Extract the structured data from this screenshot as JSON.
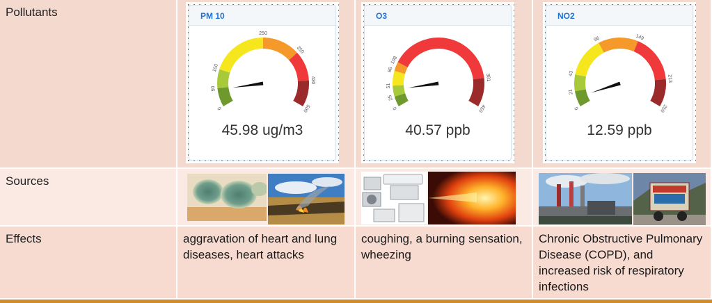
{
  "rows": {
    "pollutants": "Pollutants",
    "sources": "Sources",
    "effects": "Effects"
  },
  "gauges": [
    {
      "title": "PM 10",
      "reading": "45.98 ug/m3",
      "max": 500,
      "value": 45.98,
      "ticks": [
        "0",
        "50",
        "100",
        "250",
        "350",
        "430",
        "500"
      ],
      "tick_values": [
        0,
        50,
        100,
        250,
        350,
        430,
        500
      ],
      "bands": [
        {
          "from": 0,
          "to": 50,
          "color": "#6e9a2d"
        },
        {
          "from": 50,
          "to": 100,
          "color": "#a8c93a"
        },
        {
          "from": 100,
          "to": 250,
          "color": "#f5e61e"
        },
        {
          "from": 250,
          "to": 350,
          "color": "#f59a2a"
        },
        {
          "from": 350,
          "to": 430,
          "color": "#f0393a"
        },
        {
          "from": 430,
          "to": 500,
          "color": "#9b2b2b"
        }
      ]
    },
    {
      "title": "O3",
      "reading": "40.57 ppb",
      "max": 450,
      "value": 40.57,
      "ticks": [
        "0",
        "25",
        "51",
        "86",
        "108",
        "381",
        "450"
      ],
      "tick_values": [
        0,
        25,
        51,
        86,
        108,
        381,
        450
      ],
      "bands": [
        {
          "from": 0,
          "to": 25,
          "color": "#6e9a2d"
        },
        {
          "from": 25,
          "to": 51,
          "color": "#a8c93a"
        },
        {
          "from": 51,
          "to": 86,
          "color": "#f5e61e"
        },
        {
          "from": 86,
          "to": 108,
          "color": "#f59a2a"
        },
        {
          "from": 108,
          "to": 381,
          "color": "#f0393a"
        },
        {
          "from": 381,
          "to": 450,
          "color": "#9b2b2b"
        }
      ]
    },
    {
      "title": "NO2",
      "reading": "12.59 ppb",
      "max": 250,
      "value": 12.59,
      "ticks": [
        "0",
        "21",
        "43",
        "96",
        "149",
        "213",
        "250"
      ],
      "tick_values": [
        0,
        21,
        43,
        96,
        149,
        213,
        250
      ],
      "bands": [
        {
          "from": 0,
          "to": 21,
          "color": "#6e9a2d"
        },
        {
          "from": 21,
          "to": 43,
          "color": "#a8c93a"
        },
        {
          "from": 43,
          "to": 96,
          "color": "#f5e61e"
        },
        {
          "from": 96,
          "to": 149,
          "color": "#f59a2a"
        },
        {
          "from": 149,
          "to": 213,
          "color": "#f0393a"
        },
        {
          "from": 213,
          "to": 250,
          "color": "#9b2b2b"
        }
      ]
    }
  ],
  "source_images": [
    [
      "mold-image",
      "field-fire-image"
    ],
    [
      "air-conditioners-image",
      "fire-flame-image"
    ],
    [
      "factory-smokestacks-image",
      "truck-image"
    ]
  ],
  "effects": [
    "aggravation of heart and lung diseases, heart attacks",
    "coughing, a burning sensation, wheezing",
    "Chronic Obstructive Pulmonary Disease (COPD), and increased risk of respiratory infections"
  ],
  "colors": {
    "header_title": "#1e73d8",
    "row1_bg": "#f4d9ce",
    "row2_bg": "#fbeae4",
    "row3_bg": "#f7dbd0",
    "needle": "#111111",
    "bottom_rule": "#d08b2a"
  }
}
